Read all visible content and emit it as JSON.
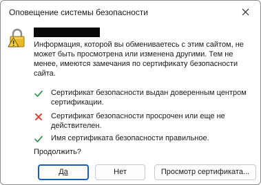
{
  "window": {
    "title": "Оповещение системы безопасности"
  },
  "message": {
    "intro": "Информация, которой вы обмениваетесь с этим сайтом, не может быть просмотрена или изменена другими. Тем не менее, имеются замечания по сертификату безопасности сайта."
  },
  "checks": [
    {
      "status": "ok",
      "icon": "check-icon",
      "text": "Сертификат безопасности выдан доверенным центром сертификации."
    },
    {
      "status": "error",
      "icon": "cross-icon",
      "text": "Сертификат безопасности просрочен или еще не действителен."
    },
    {
      "status": "ok",
      "icon": "check-icon",
      "text": "Имя сертификата безопасности правильное."
    }
  ],
  "prompt": "Продолжить?",
  "buttons": {
    "yes": "Да",
    "no": "Нет",
    "view_certificate": "Просмотр сертификата..."
  },
  "colors": {
    "ok": "#3a9a5b",
    "error": "#d6453a",
    "default_button_border": "#1a5fb4",
    "lock_gold": "#e8b92c"
  }
}
